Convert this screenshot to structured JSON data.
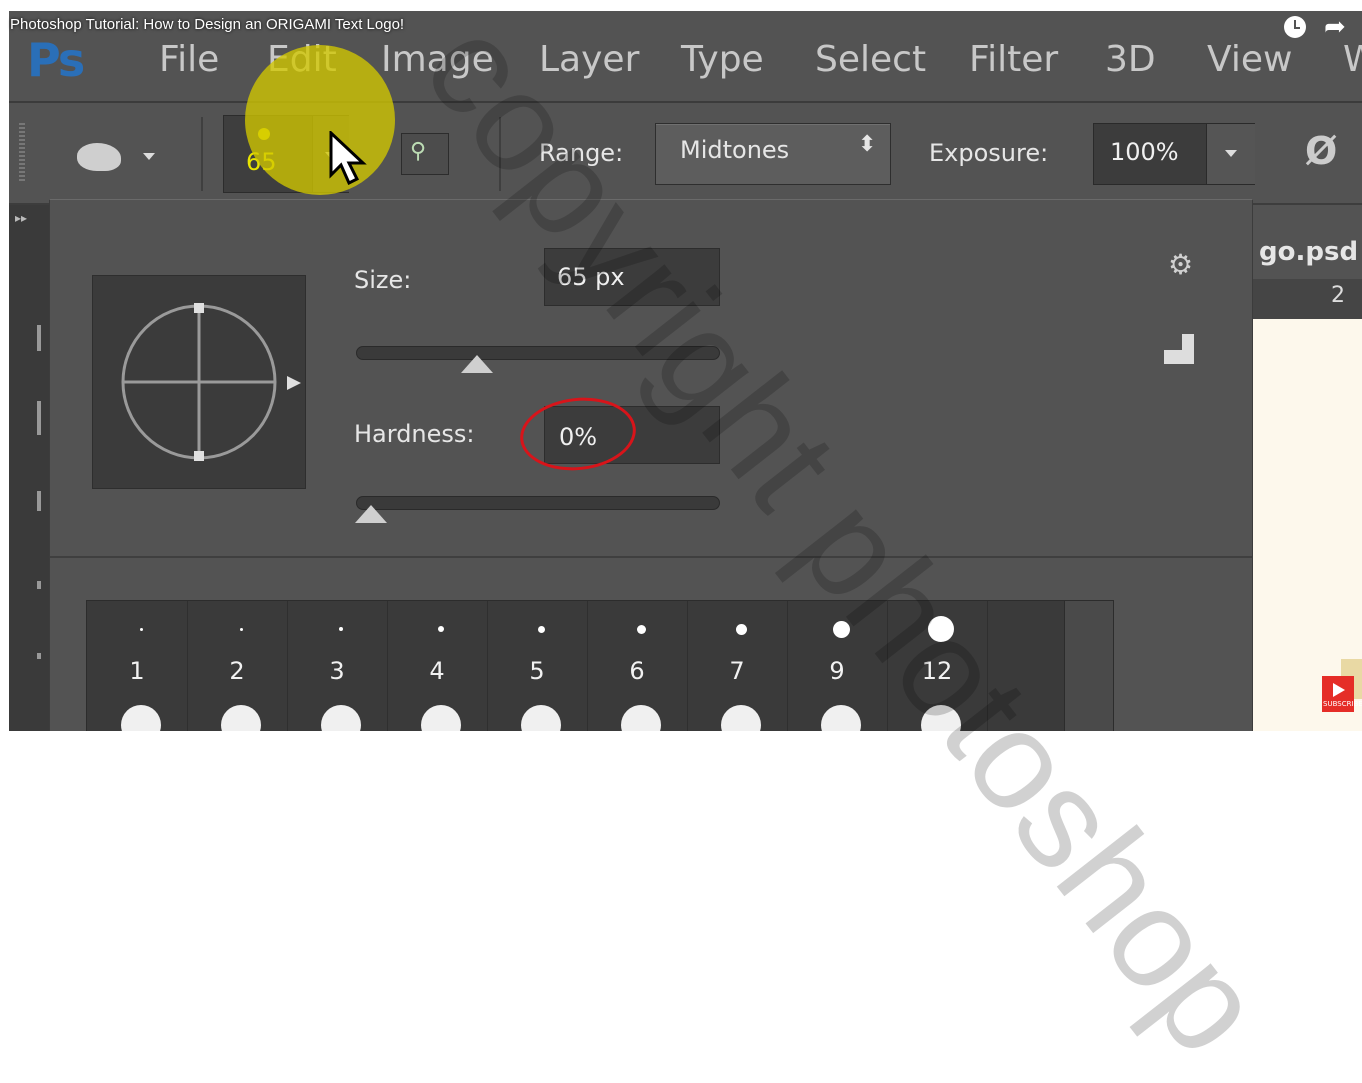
{
  "video": {
    "title": "Photoshop Tutorial: How to Design an ORIGAMI Text Logo!"
  },
  "app": {
    "logo": "Ps",
    "menu": [
      "File",
      "Edit",
      "Image",
      "Layer",
      "Type",
      "Select",
      "Filter",
      "3D",
      "View",
      "W"
    ]
  },
  "options_bar": {
    "brush_size": "65",
    "range_label": "Range:",
    "range_value": "Midtones",
    "exposure_label": "Exposure:",
    "exposure_value": "100%"
  },
  "brush_panel": {
    "size_label": "Size:",
    "size_value": "65 px",
    "size_slider_fraction": 0.32,
    "hardness_label": "Hardness:",
    "hardness_value": "0%",
    "hardness_slider_fraction": 0.0,
    "presets": [
      "1",
      "2",
      "3",
      "4",
      "5",
      "6",
      "7",
      "9",
      "12"
    ]
  },
  "document": {
    "tab_title": "go.psd",
    "ruler_number": "2"
  },
  "overlay": {
    "subscribe": "SUBSCRIBE"
  },
  "colors": {
    "accent_yellow": "#e8e400",
    "annotation_red": "#d8141a",
    "ps_blue": "#2a6fb8"
  },
  "icons": [
    "clock-icon",
    "share-icon",
    "dodge-tool-icon",
    "airbrush-icon",
    "gear-icon",
    "new-preset-icon"
  ]
}
